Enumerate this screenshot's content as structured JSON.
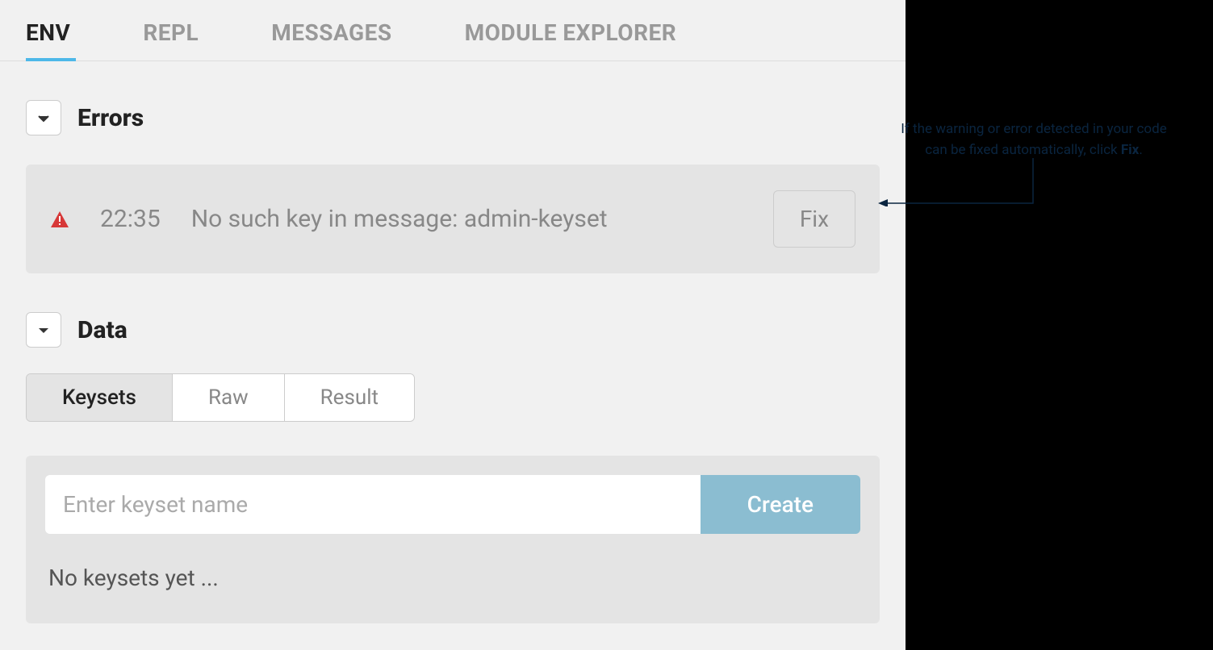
{
  "tabs": {
    "env": "ENV",
    "repl": "REPL",
    "messages": "MESSAGES",
    "module_explorer": "MODULE EXPLORER"
  },
  "errors_section": {
    "title": "Errors",
    "items": [
      {
        "time": "22:35",
        "message": "No such key in message: admin-keyset",
        "fix_label": "Fix"
      }
    ]
  },
  "data_section": {
    "title": "Data",
    "tabs": {
      "keysets": "Keysets",
      "raw": "Raw",
      "result": "Result"
    },
    "keyset_input_placeholder": "Enter keyset name",
    "create_label": "Create",
    "empty_message": "No keysets yet ..."
  },
  "annotation": {
    "line1": "If the warning or error detected in your code",
    "line2_prefix": "can be fixed automatically, click ",
    "line2_bold": "Fix",
    "line2_suffix": "."
  }
}
